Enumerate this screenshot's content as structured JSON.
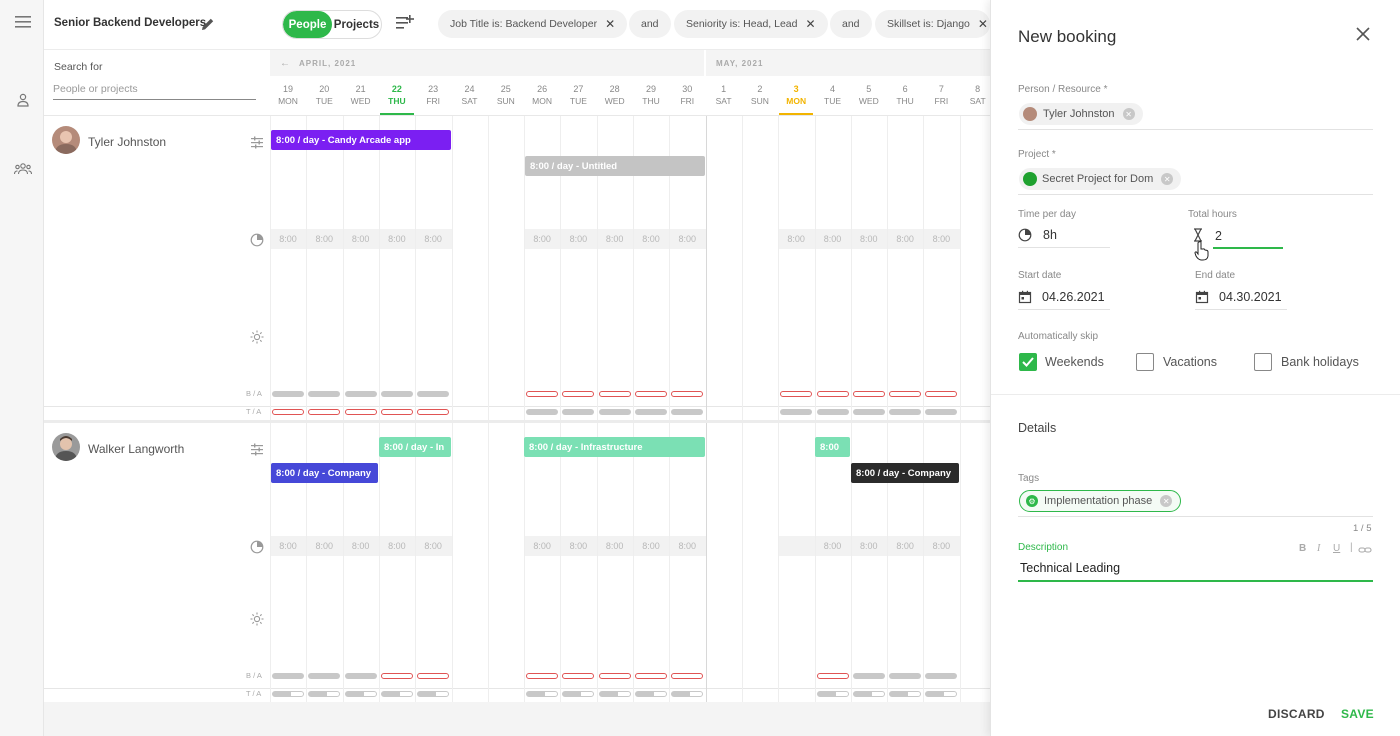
{
  "topbar": {
    "view_title": "Senior Backend Developers",
    "toggle": {
      "people": "People",
      "projects": "Projects"
    },
    "filters": [
      {
        "label": "Job Title is: Backend Developer",
        "removable": true
      },
      {
        "label": "and",
        "removable": false
      },
      {
        "label": "Seniority is: Head, Lead",
        "removable": true
      },
      {
        "label": "and",
        "removable": false
      },
      {
        "label": "Skillset is: Django",
        "removable": true
      }
    ]
  },
  "search": {
    "label": "Search for",
    "placeholder": "People or projects"
  },
  "calendar": {
    "months": [
      "APRIL, 2021",
      "MAY, 2021"
    ],
    "days": [
      {
        "num": "19",
        "dow": "MON"
      },
      {
        "num": "20",
        "dow": "TUE"
      },
      {
        "num": "21",
        "dow": "WED"
      },
      {
        "num": "22",
        "dow": "THU",
        "state": "today"
      },
      {
        "num": "23",
        "dow": "FRI"
      },
      {
        "num": "24",
        "dow": "SAT"
      },
      {
        "num": "25",
        "dow": "SUN"
      },
      {
        "num": "26",
        "dow": "MON"
      },
      {
        "num": "27",
        "dow": "TUE"
      },
      {
        "num": "28",
        "dow": "WED"
      },
      {
        "num": "29",
        "dow": "THU"
      },
      {
        "num": "30",
        "dow": "FRI"
      },
      {
        "num": "1",
        "dow": "SAT"
      },
      {
        "num": "2",
        "dow": "SUN"
      },
      {
        "num": "3",
        "dow": "MON",
        "state": "holiday"
      },
      {
        "num": "4",
        "dow": "TUE"
      },
      {
        "num": "5",
        "dow": "WED"
      },
      {
        "num": "6",
        "dow": "THU"
      },
      {
        "num": "7",
        "dow": "FRI"
      },
      {
        "num": "8",
        "dow": "SAT"
      }
    ],
    "capacity_label": "8:00",
    "ba_label": "B / A",
    "ta_label": "T / A"
  },
  "people": [
    {
      "name": "Tyler Johnston",
      "bookings": [
        {
          "label": "8:00 / day - Candy Arcade app",
          "color": "#7b1ff2"
        },
        {
          "label": "8:00 / day - Untitled",
          "color": "#c4c4c4"
        }
      ]
    },
    {
      "name": "Walker Langworth",
      "bookings": [
        {
          "label": "8:00 / day - In",
          "color": "#7be0b4"
        },
        {
          "label": "8:00 / day - Infrastructure",
          "color": "#7be0b4"
        },
        {
          "label": "8:00",
          "color": "#7be0b4"
        },
        {
          "label": "8:00 / day - Company",
          "color": "#4648d8"
        },
        {
          "label": "8:00 / day - Company",
          "color": "#2b2b2b"
        }
      ]
    }
  ],
  "panel": {
    "title": "New booking",
    "person_label": "Person / Resource *",
    "person_value": "Tyler Johnston",
    "project_label": "Project *",
    "project_value": "Secret Project for Dom",
    "project_color": "#1fa12f",
    "time_per_day_label": "Time per day",
    "time_per_day_value": "8h",
    "total_hours_label": "Total hours",
    "total_hours_value": "2",
    "start_date_label": "Start date",
    "start_date_value": "04.26.2021",
    "end_date_label": "End date",
    "end_date_value": "04.30.2021",
    "skip_label": "Automatically skip",
    "skip_options": [
      {
        "label": "Weekends",
        "checked": true
      },
      {
        "label": "Vacations",
        "checked": false
      },
      {
        "label": "Bank holidays",
        "checked": false
      }
    ],
    "details_label": "Details",
    "tags_label": "Tags",
    "tag_value": "Implementation phase",
    "tag_count": "1 / 5",
    "description_label": "Description",
    "description_value": "Technical Leading",
    "accent": "#2eb84a",
    "discard_label": "DISCARD",
    "save_label": "SAVE"
  }
}
